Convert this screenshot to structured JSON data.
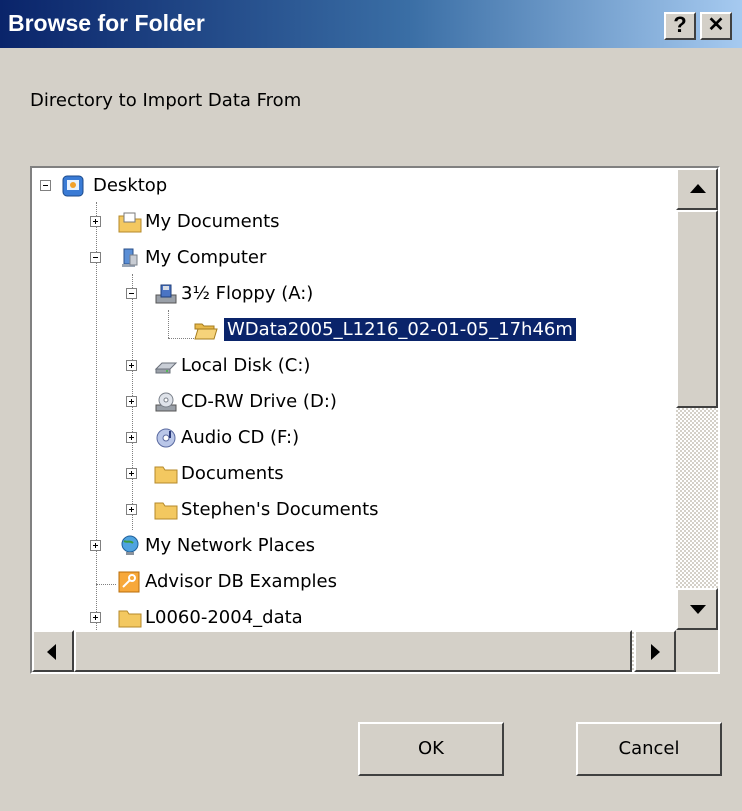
{
  "window": {
    "title": "Browse for Folder",
    "help_label": "?",
    "close_label": "✕"
  },
  "prompt": "Directory to Import Data From",
  "tree": {
    "items": [
      {
        "label": "Desktop",
        "icon": "desktop-icon",
        "expander": "minus"
      },
      {
        "label": "My Documents",
        "icon": "my-documents-icon",
        "expander": "plus"
      },
      {
        "label": "My Computer",
        "icon": "my-computer-icon",
        "expander": "minus"
      },
      {
        "label": "3½ Floppy (A:)",
        "icon": "floppy-drive-icon",
        "expander": "minus"
      },
      {
        "label": "WData2005_L1216_02-01-05_17h46m",
        "icon": "open-folder-icon",
        "expander": "none",
        "selected": true
      },
      {
        "label": "Local Disk (C:)",
        "icon": "local-disk-icon",
        "expander": "plus"
      },
      {
        "label": "CD-RW Drive (D:)",
        "icon": "cd-drive-icon",
        "expander": "plus"
      },
      {
        "label": "Audio CD (F:)",
        "icon": "audio-cd-icon",
        "expander": "plus"
      },
      {
        "label": "Documents",
        "icon": "folder-icon",
        "expander": "plus"
      },
      {
        "label": "Stephen's Documents",
        "icon": "folder-icon",
        "expander": "plus"
      },
      {
        "label": "My Network Places",
        "icon": "network-places-icon",
        "expander": "plus"
      },
      {
        "label": "Advisor DB Examples",
        "icon": "shortcut-key-icon",
        "expander": "none"
      },
      {
        "label": "L0060-2004_data",
        "icon": "folder-icon",
        "expander": "plus"
      }
    ]
  },
  "buttons": {
    "ok": "OK",
    "cancel": "Cancel"
  },
  "colors": {
    "titlebar_start": "#0a246a",
    "titlebar_end": "#a6caf0",
    "selection": "#0a246a",
    "face": "#d4d0c8"
  }
}
